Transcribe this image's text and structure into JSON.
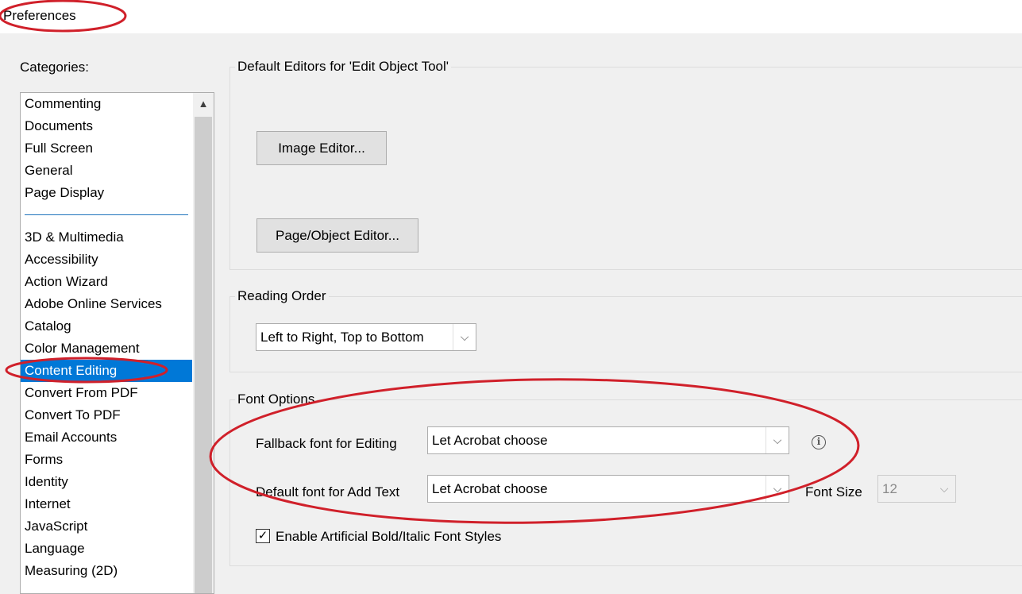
{
  "window": {
    "title": "Preferences"
  },
  "categories": {
    "label": "Categories:",
    "group1": [
      "Commenting",
      "Documents",
      "Full Screen",
      "General",
      "Page Display"
    ],
    "group2": [
      "3D & Multimedia",
      "Accessibility",
      "Action Wizard",
      "Adobe Online Services",
      "Catalog",
      "Color Management",
      "Content Editing",
      "Convert From PDF",
      "Convert To PDF",
      "Email Accounts",
      "Forms",
      "Identity",
      "Internet",
      "JavaScript",
      "Language",
      "Measuring (2D)"
    ],
    "selected": "Content Editing"
  },
  "default_editors": {
    "title": "Default Editors for 'Edit Object Tool'",
    "image_editor_label": "Image Editor...",
    "page_object_editor_label": "Page/Object Editor..."
  },
  "reading_order": {
    "title": "Reading Order",
    "selected": "Left to Right, Top to Bottom"
  },
  "font_options": {
    "title": "Font Options",
    "fallback_label": "Fallback font for Editing",
    "fallback_value": "Let Acrobat choose",
    "default_label": "Default font for Add Text",
    "default_value": "Let Acrobat choose",
    "font_size_label": "Font Size",
    "font_size_value": "12",
    "artificial_styles_label": "Enable Artificial Bold/Italic Font Styles",
    "artificial_styles_checked": true
  },
  "icons": {
    "info": "info-icon",
    "check": "checkmark-icon",
    "dropdown": "chevron-down-icon",
    "scroll_up": "chevron-up-icon"
  },
  "colors": {
    "selection": "#0078d7",
    "annotation": "#d0202a"
  }
}
